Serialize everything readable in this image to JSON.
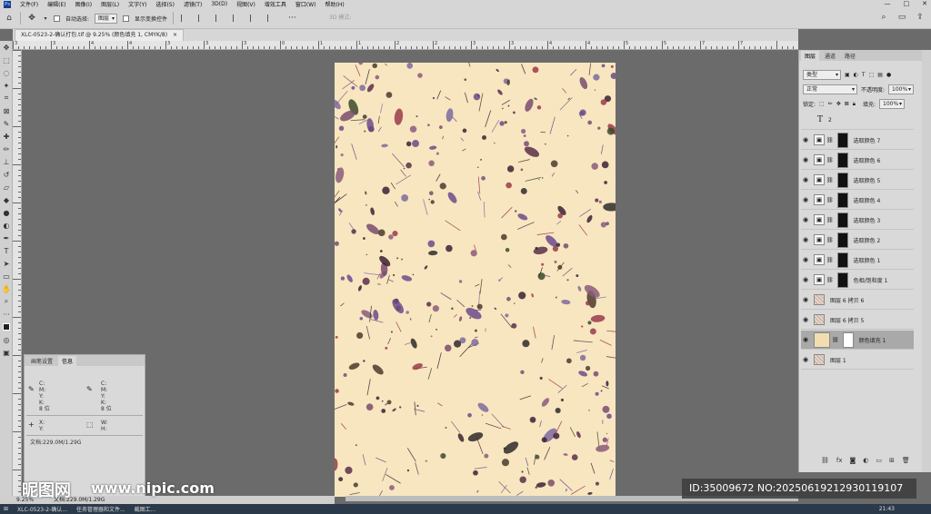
{
  "menubar": {
    "items": [
      "文件(F)",
      "编辑(E)",
      "图像(I)",
      "图层(L)",
      "文字(Y)",
      "选择(S)",
      "滤镜(T)",
      "3D(D)",
      "视图(V)",
      "增效工具",
      "窗口(W)",
      "帮助(H)"
    ],
    "window_controls": [
      "—",
      "□",
      "✕"
    ]
  },
  "options": {
    "auto_select_label": "自动选择:",
    "auto_select_value": "图层",
    "show_transform_label": "显示变换控件",
    "more": "···",
    "mode_3d": "3D 模式:"
  },
  "document_tab": {
    "label": "XLC-0523-2-确认打包.tif @ 9.25% (颜色填充 1, CMYK/8)"
  },
  "ruler": {
    "labels": [
      "3",
      "3",
      "4",
      "4",
      "3",
      "3",
      "3",
      "0",
      "1",
      "1",
      "2",
      "2",
      "3",
      "3",
      "4",
      "4",
      "5",
      "5",
      "7",
      "7"
    ]
  },
  "info_panel": {
    "tabs": [
      "画笔设置",
      "信息"
    ],
    "left_cmyk": [
      "C:",
      "M:",
      "Y:",
      "K:"
    ],
    "left_bits": "8 位",
    "right_cmyk": [
      "C:",
      "M:",
      "Y:",
      "K:"
    ],
    "right_bits": "8 位",
    "xy": [
      "X:",
      "Y:"
    ],
    "wh": [
      "W:",
      "H:"
    ],
    "doc": "文档:229.0M/1.29G"
  },
  "layers_panel": {
    "tabs": [
      "图层",
      "通道",
      "路径"
    ],
    "kind": "类型",
    "blend_mode": "正常",
    "opacity_label": "不透明度:",
    "opacity": "100%",
    "lock_label": "锁定:",
    "fill_label": "填充:",
    "fill": "100%",
    "layers": [
      {
        "name": "2",
        "type": "text",
        "visible": false
      },
      {
        "name": "选取颜色 7",
        "type": "adj",
        "visible": true
      },
      {
        "name": "选取颜色 6",
        "type": "adj",
        "visible": true
      },
      {
        "name": "选取颜色 5",
        "type": "adj",
        "visible": true
      },
      {
        "name": "选取颜色 4",
        "type": "adj",
        "visible": true
      },
      {
        "name": "选取颜色 3",
        "type": "adj",
        "visible": true
      },
      {
        "name": "选取颜色 2",
        "type": "adj",
        "visible": true
      },
      {
        "name": "选取颜色 1",
        "type": "adj",
        "visible": true
      },
      {
        "name": "色相/饱和度 1",
        "type": "adj",
        "visible": true
      },
      {
        "name": "图层 6 拷贝 6",
        "type": "pixel",
        "visible": true
      },
      {
        "name": "图层 6 拷贝 5",
        "type": "pixel",
        "visible": true
      },
      {
        "name": "颜色填充 1",
        "type": "fill",
        "visible": true,
        "selected": true
      },
      {
        "name": "图层 1",
        "type": "pixel",
        "visible": true
      }
    ]
  },
  "status": {
    "zoom": "9.25%",
    "doc": "文档:229.0M/1.29G"
  },
  "taskbar": {
    "items": [
      "XLC-0523-2-确认...",
      "任务管理器和文件...",
      "截图工..."
    ],
    "time": "21:43"
  },
  "watermark": {
    "logo": "昵图网",
    "url": "www.nipic.com",
    "id": "ID:35009672 NO:20250619212930119107"
  },
  "colors": {
    "canvas_bg": "#f8e6c1",
    "fill_swatch": "#f3ddb0",
    "workspace": "#6b6b6b"
  }
}
